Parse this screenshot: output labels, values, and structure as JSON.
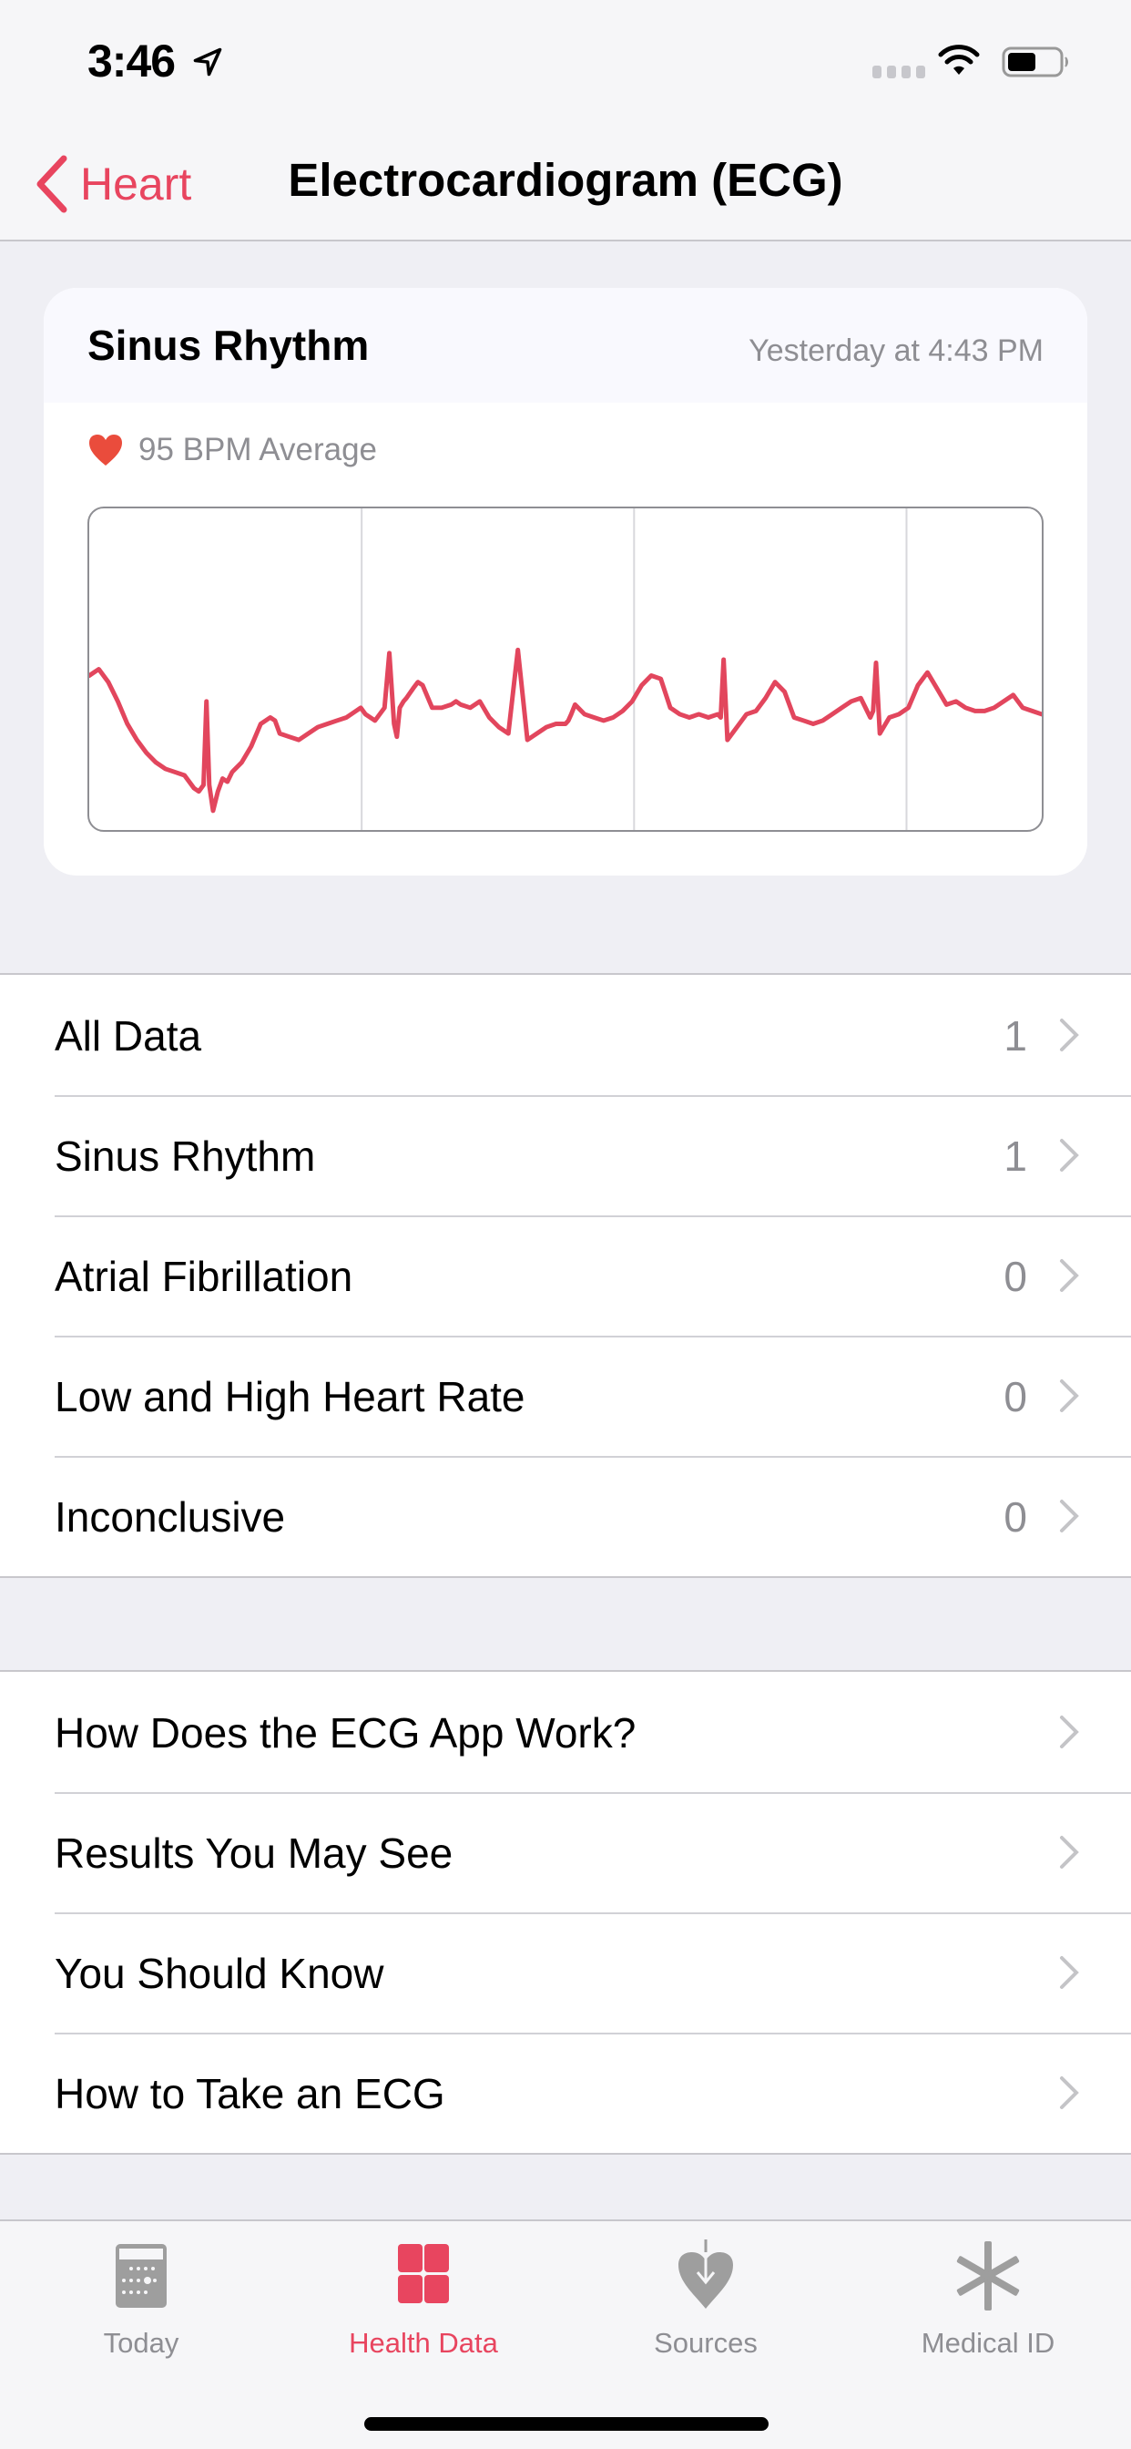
{
  "status_bar": {
    "time": "3:46",
    "icons": [
      "location-arrow-icon",
      "cellular-signal-icon",
      "wifi-icon",
      "battery-icon"
    ]
  },
  "nav": {
    "back_label": "Heart",
    "title": "Electrocardiogram (ECG)"
  },
  "recording": {
    "classification": "Sinus Rhythm",
    "timestamp": "Yesterday at 4:43 PM",
    "average": "95 BPM Average"
  },
  "colors": {
    "accent": "#e8455f",
    "trace": "#e2465d",
    "heart": "#ea4c3c",
    "secondary_text": "#8e8e93",
    "background": "#efeff4"
  },
  "chart_data": {
    "type": "line",
    "title": "",
    "xlabel": "",
    "ylabel": "",
    "grid": "vertical lines only",
    "description": "Single-lead ECG waveform, approx. 3.5 segments shown, 7 QRS complexes",
    "x_range": [
      0,
      100
    ],
    "y_range": [
      0,
      100
    ],
    "x": [
      0,
      1,
      2,
      3,
      4,
      5,
      6,
      7,
      8,
      9,
      10,
      11,
      11.5,
      12,
      12.3,
      12.6,
      13,
      13.5,
      14,
      14.5,
      15,
      16,
      17,
      18,
      19,
      19.5,
      20,
      21,
      22,
      23,
      24,
      25,
      26,
      27,
      28,
      28.5,
      29,
      30,
      31,
      31.5,
      32,
      32.3,
      32.6,
      33,
      33.3,
      34,
      34.5,
      35,
      36,
      37,
      38,
      38.5,
      39,
      40,
      41,
      42,
      43,
      44,
      45,
      46,
      47,
      48,
      49,
      50,
      50.3,
      50.6,
      51,
      52,
      53,
      54,
      55,
      56,
      57,
      58,
      59,
      60,
      61,
      62,
      63,
      64,
      65,
      66,
      66.3,
      66.6,
      67,
      68,
      69,
      70,
      71,
      72,
      73,
      74,
      75,
      76,
      77,
      78,
      79,
      80,
      81,
      82,
      82.3,
      82.6,
      83,
      84,
      85,
      86,
      87,
      88,
      89,
      90,
      91,
      92,
      93,
      94,
      95,
      96,
      97,
      98,
      99,
      100
    ],
    "y": [
      48,
      50,
      46,
      40,
      33,
      28,
      24,
      21,
      19,
      18,
      17,
      13,
      12,
      14,
      40,
      14,
      6,
      12,
      16,
      15,
      18,
      21,
      26,
      33,
      35,
      34,
      30,
      29,
      28,
      30,
      32,
      33,
      34,
      35,
      37,
      38,
      36,
      34,
      38,
      55,
      33,
      29,
      38,
      40,
      41,
      44,
      46,
      45,
      38,
      38,
      39,
      40,
      39,
      38,
      40,
      35,
      32,
      30,
      56,
      28,
      30,
      32,
      33,
      33,
      34,
      36,
      39,
      36,
      35,
      34,
      35,
      37,
      40,
      45,
      48,
      47,
      38,
      36,
      35,
      36,
      35,
      36,
      35,
      53,
      28,
      32,
      36,
      37,
      41,
      46,
      43,
      35,
      34,
      33,
      34,
      36,
      38,
      40,
      41,
      35,
      37,
      52,
      30,
      35,
      36,
      38,
      45,
      49,
      44,
      39,
      40,
      38,
      37,
      37,
      38,
      40,
      42,
      38,
      37,
      36,
      36,
      42
    ]
  },
  "categories": [
    {
      "label": "All Data",
      "count": "1"
    },
    {
      "label": "Sinus Rhythm",
      "count": "1"
    },
    {
      "label": "Atrial Fibrillation",
      "count": "0"
    },
    {
      "label": "Low and High Heart Rate",
      "count": "0"
    },
    {
      "label": "Inconclusive",
      "count": "0"
    }
  ],
  "info_links": [
    {
      "label": "How Does the ECG App Work?"
    },
    {
      "label": "Results You May See"
    },
    {
      "label": "You Should Know"
    },
    {
      "label": "How to Take an ECG"
    }
  ],
  "tab_bar": {
    "active": "Health Data",
    "tabs": [
      {
        "label": "Today",
        "icon": "calendar-icon"
      },
      {
        "label": "Health Data",
        "icon": "grid-icon"
      },
      {
        "label": "Sources",
        "icon": "heart-download-icon"
      },
      {
        "label": "Medical ID",
        "icon": "asterisk-icon"
      }
    ]
  }
}
